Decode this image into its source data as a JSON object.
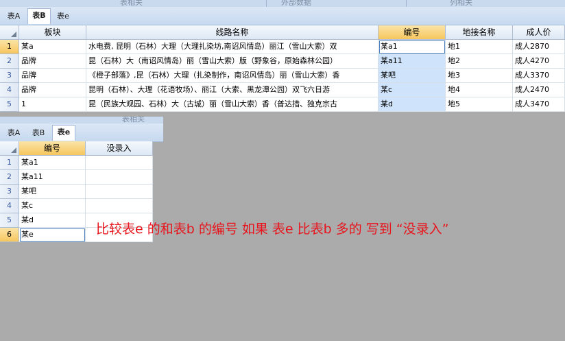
{
  "top_strip": {
    "labels": [
      "表相关",
      "外部数据",
      "列相关"
    ]
  },
  "upper_sheet": {
    "tabs": [
      "表A",
      "表B",
      "表e"
    ],
    "active_tab": "表B",
    "columns": [
      "板块",
      "线路名称",
      "编号",
      "地接名称",
      "成人价"
    ],
    "rows": [
      {
        "num": "1",
        "cells": [
          "某a",
          "水电费, 昆明（石林）大理（大理扎染坊,南诏风情岛）丽江（雪山大索）双",
          "某a1",
          "地1",
          "成人2870"
        ]
      },
      {
        "num": "2",
        "cells": [
          "品牌",
          "昆（石林）大（南诏风情岛）丽（雪山大索）版（野象谷，原始森林公园）",
          "某a11",
          "地2",
          "成人4270"
        ]
      },
      {
        "num": "3",
        "cells": [
          "品牌",
          "《橙子部落》,昆（石林）大理（扎染制作，南诏风情岛）丽（雪山大索）香",
          "某吧",
          "地3",
          "成人3370"
        ]
      },
      {
        "num": "4",
        "cells": [
          "品牌",
          "昆明（石林）、大理（花语牧场）、丽江（大索、黑龙潭公园）双飞六日游",
          "某c",
          "地4",
          "成人2470"
        ]
      },
      {
        "num": "5",
        "cells": [
          "1",
          "昆（民族大观园、石林）大（古城）丽（雪山大索）香（普达措、独克宗古",
          "某d",
          "地5",
          "成人3470"
        ]
      }
    ]
  },
  "lower_sheet": {
    "strip_label": "表相关",
    "tabs": [
      "表A",
      "表B",
      "表e"
    ],
    "active_tab": "表e",
    "columns": [
      "编号",
      "没录入"
    ],
    "rows": [
      {
        "num": "1",
        "cells": [
          "某a1",
          ""
        ]
      },
      {
        "num": "2",
        "cells": [
          "某a11",
          ""
        ]
      },
      {
        "num": "3",
        "cells": [
          "某吧",
          ""
        ]
      },
      {
        "num": "4",
        "cells": [
          "某c",
          ""
        ]
      },
      {
        "num": "5",
        "cells": [
          "某d",
          ""
        ]
      },
      {
        "num": "6",
        "cells": [
          "某e",
          ""
        ]
      }
    ]
  },
  "annotation": "比较表e 的和表b 的编号 如果 表e 比表b 多的 写到 “没录入”",
  "colors": {
    "annotation": "#e8141c",
    "selected_header": "#f6c65e",
    "selected_column": "#cfe3fa"
  }
}
